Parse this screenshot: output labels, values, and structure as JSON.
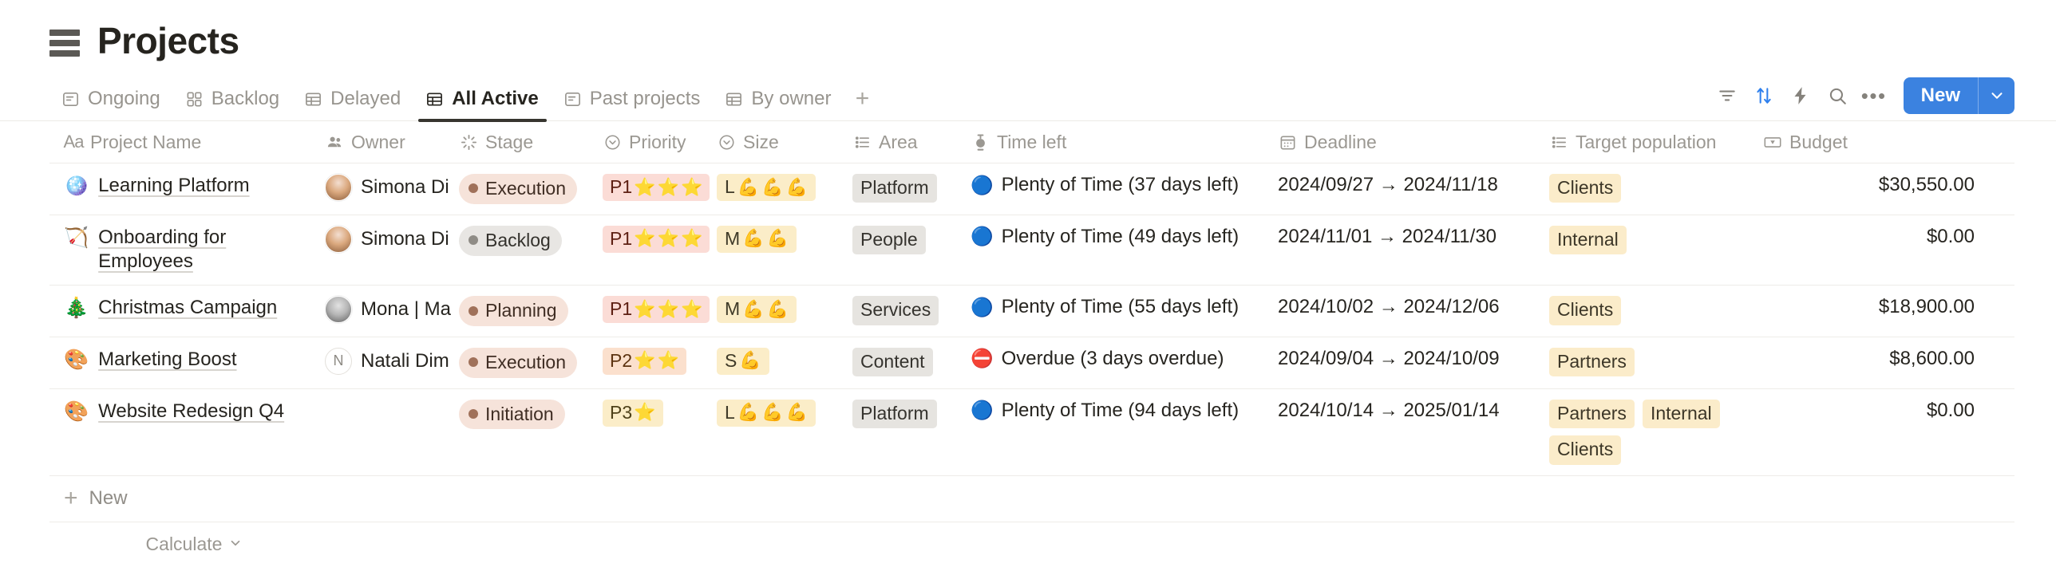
{
  "header": {
    "title": "Projects",
    "icon": "database-menu-icon"
  },
  "tabs": [
    {
      "label": "Ongoing",
      "icon": "list-view-icon",
      "active": false
    },
    {
      "label": "Backlog",
      "icon": "gallery-view-icon",
      "active": false
    },
    {
      "label": "Delayed",
      "icon": "table-view-icon",
      "active": false
    },
    {
      "label": "All Active",
      "icon": "table-view-icon",
      "active": true
    },
    {
      "label": "Past projects",
      "icon": "list-view-icon",
      "active": false
    },
    {
      "label": "By owner",
      "icon": "table-view-icon",
      "active": false
    }
  ],
  "tab_add_label": "+",
  "toolbar": {
    "filter_icon": "filter-icon",
    "sort_icon": "sort-icon",
    "automation_icon": "lightning-icon",
    "search_icon": "search-icon",
    "more_label": "•••",
    "new_label": "New",
    "caret_icon": "chevron-down-icon",
    "accent_color": "#2f80ed",
    "new_button_color": "#3b82e0"
  },
  "columns": [
    {
      "label": "Project Name",
      "icon": "text-type-icon"
    },
    {
      "label": "Owner",
      "icon": "person-icon"
    },
    {
      "label": "Stage",
      "icon": "status-icon"
    },
    {
      "label": "Priority",
      "icon": "select-icon"
    },
    {
      "label": "Size",
      "icon": "select-icon"
    },
    {
      "label": "Area",
      "icon": "multi-select-icon"
    },
    {
      "label": "Time left",
      "icon": "formula-timer-icon"
    },
    {
      "label": "Deadline",
      "icon": "calendar-icon"
    },
    {
      "label": "Target population",
      "icon": "multi-select-icon"
    },
    {
      "label": "Budget",
      "icon": "currency-icon"
    }
  ],
  "rows": [
    {
      "emoji": "🪩",
      "name": "Learning Platform",
      "owner": {
        "name": "Simona Di",
        "avatar_type": "photo",
        "avatar_color": "#d8a27a"
      },
      "stage": {
        "label": "Execution",
        "dot": "#a0715a",
        "bg": "#f6e3da",
        "fg": "#3f2d23"
      },
      "priority": {
        "label": "P1",
        "stars": 3,
        "class": "p1"
      },
      "size": {
        "label": "L",
        "muscles": 3
      },
      "area": "Platform",
      "time_left": {
        "status": "Plenty of Time (37 days left)",
        "dot": "🔵"
      },
      "deadline": "2024/09/27 → 2024/11/18",
      "target_population": [
        "Clients"
      ],
      "budget": "$30,550.00"
    },
    {
      "emoji": "🏹",
      "name": "Onboarding for Employees",
      "owner": {
        "name": "Simona Di",
        "avatar_type": "photo",
        "avatar_color": "#d8a27a"
      },
      "stage": {
        "label": "Backlog",
        "dot": "#8f8c86",
        "bg": "#e8e6e3",
        "fg": "#33312c"
      },
      "priority": {
        "label": "P1",
        "stars": 3,
        "class": "p1"
      },
      "size": {
        "label": "M",
        "muscles": 2
      },
      "area": "People",
      "time_left": {
        "status": "Plenty of Time (49 days left)",
        "dot": "🔵"
      },
      "deadline": "2024/11/01 → 2024/11/30",
      "target_population": [
        "Internal"
      ],
      "budget": "$0.00"
    },
    {
      "emoji": "🎄",
      "name": "Christmas Campaign",
      "owner": {
        "name": "Mona | Ma",
        "avatar_type": "photo",
        "avatar_color": "#9a9a9a"
      },
      "stage": {
        "label": "Planning",
        "dot": "#a0715a",
        "bg": "#f6e3da",
        "fg": "#3f2d23"
      },
      "priority": {
        "label": "P1",
        "stars": 3,
        "class": "p1"
      },
      "size": {
        "label": "M",
        "muscles": 2
      },
      "area": "Services",
      "time_left": {
        "status": "Plenty of Time (55 days left)",
        "dot": "🔵"
      },
      "deadline": "2024/10/02 → 2024/12/06",
      "target_population": [
        "Clients"
      ],
      "budget": "$18,900.00"
    },
    {
      "emoji": "🎨",
      "name": "Marketing Boost",
      "owner": {
        "name": "Natali Dim",
        "avatar_type": "letter",
        "initial": "N"
      },
      "stage": {
        "label": "Execution",
        "dot": "#a0715a",
        "bg": "#f6e3da",
        "fg": "#3f2d23"
      },
      "priority": {
        "label": "P2",
        "stars": 2,
        "class": "p2"
      },
      "size": {
        "label": "S",
        "muscles": 1
      },
      "area": "Content",
      "time_left": {
        "status": "Overdue (3 days overdue)",
        "dot": "⛔"
      },
      "deadline": "2024/09/04 → 2024/10/09",
      "target_population": [
        "Partners"
      ],
      "budget": "$8,600.00"
    },
    {
      "emoji": "🎨",
      "name": "Website Redesign Q4",
      "owner": null,
      "stage": {
        "label": "Initiation",
        "dot": "#a0715a",
        "bg": "#f6e3da",
        "fg": "#3f2d23"
      },
      "priority": {
        "label": "P3",
        "stars": 1,
        "class": "p3"
      },
      "size": {
        "label": "L",
        "muscles": 3
      },
      "area": "Platform",
      "time_left": {
        "status": "Plenty of Time (94 days left)",
        "dot": "🔵"
      },
      "deadline": "2024/10/14 → 2025/01/14",
      "target_population": [
        "Partners",
        "Internal",
        "Clients"
      ],
      "budget": "$0.00"
    }
  ],
  "footer": {
    "new_row_label": "New",
    "new_row_icon": "plus-icon",
    "calculate_label": "Calculate",
    "calculate_icon": "chevron-down-icon"
  }
}
